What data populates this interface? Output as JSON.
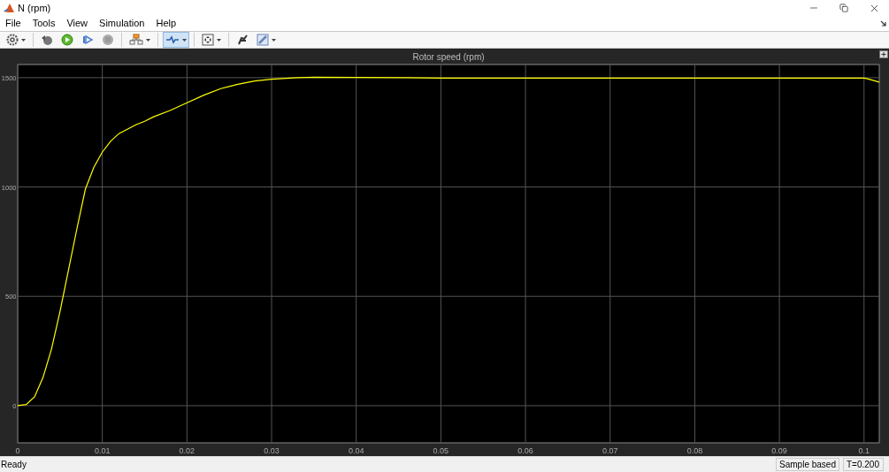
{
  "window": {
    "title": "N (rpm)"
  },
  "menu": [
    "File",
    "Tools",
    "View",
    "Simulation",
    "Help"
  ],
  "toolbar": [
    {
      "kind": "gear",
      "caret": true,
      "selected": false
    },
    {
      "kind": "sep"
    },
    {
      "kind": "rewind",
      "caret": false,
      "selected": false
    },
    {
      "kind": "run",
      "caret": false,
      "selected": false
    },
    {
      "kind": "step",
      "caret": false,
      "selected": false
    },
    {
      "kind": "stop",
      "caret": false,
      "selected": false
    },
    {
      "kind": "sep"
    },
    {
      "kind": "blocks",
      "caret": true,
      "selected": false
    },
    {
      "kind": "sep"
    },
    {
      "kind": "trigger",
      "caret": true,
      "selected": true
    },
    {
      "kind": "sep"
    },
    {
      "kind": "zoom",
      "caret": true,
      "selected": false
    },
    {
      "kind": "sep"
    },
    {
      "kind": "cursor",
      "caret": false,
      "selected": false
    },
    {
      "kind": "pencil",
      "caret": true,
      "selected": false
    }
  ],
  "plot": {
    "chart_data": {
      "type": "line",
      "title": "Rotor speed (rpm)",
      "x": [
        0,
        0.001,
        0.002,
        0.003,
        0.004,
        0.005,
        0.006,
        0.007,
        0.008,
        0.009,
        0.01,
        0.011,
        0.012,
        0.013,
        0.014,
        0.015,
        0.016,
        0.018,
        0.02,
        0.022,
        0.024,
        0.026,
        0.028,
        0.03,
        0.033,
        0.035,
        0.04,
        0.046,
        0.05,
        0.06,
        0.07,
        0.08,
        0.09,
        0.1,
        0.1004,
        0.1018
      ],
      "series": [
        {
          "color": "#ffff00",
          "values": [
            0,
            5,
            40,
            130,
            260,
            430,
            620,
            810,
            990,
            1090,
            1160,
            1210,
            1245,
            1265,
            1285,
            1300,
            1320,
            1350,
            1385,
            1420,
            1450,
            1470,
            1485,
            1493,
            1500,
            1502,
            1501,
            1500,
            1498,
            1498,
            1498,
            1498,
            1498,
            1498,
            1495,
            1480
          ]
        }
      ],
      "xlim": [
        0,
        0.1018
      ],
      "ylim": [
        -170,
        1560
      ],
      "xticks": [
        0,
        0.01,
        0.02,
        0.03,
        0.04,
        0.05,
        0.06,
        0.07,
        0.08,
        0.09,
        0.1
      ],
      "yticks": [
        0,
        500,
        1000,
        1500
      ],
      "grid": true
    }
  },
  "status": {
    "message": "Ready",
    "mode": "Sample based",
    "time": "T=0.200"
  }
}
